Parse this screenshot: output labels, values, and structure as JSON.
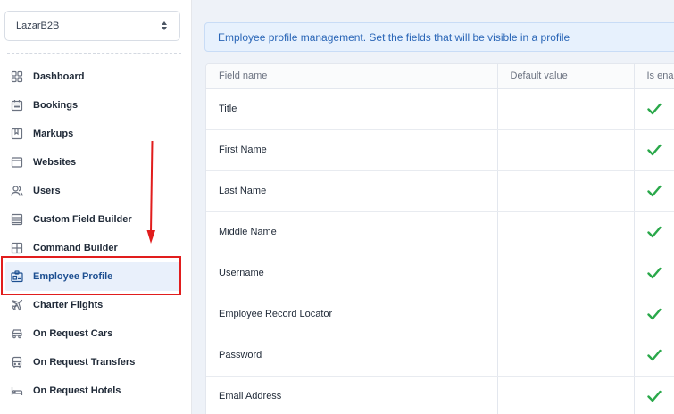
{
  "company_select": {
    "value": "LazarB2B"
  },
  "sidebar": {
    "items": [
      {
        "label": "Dashboard",
        "icon": "grid-icon"
      },
      {
        "label": "Bookings",
        "icon": "calendar-icon"
      },
      {
        "label": "Markups",
        "icon": "bookmark-icon"
      },
      {
        "label": "Websites",
        "icon": "browser-icon"
      },
      {
        "label": "Users",
        "icon": "users-icon"
      },
      {
        "label": "Custom Field Builder",
        "icon": "list-icon"
      },
      {
        "label": "Command Builder",
        "icon": "layout-icon"
      },
      {
        "label": "Employee Profile",
        "icon": "id-card-icon",
        "active": true
      },
      {
        "label": "Charter Flights",
        "icon": "plane-icon"
      },
      {
        "label": "On Request Cars",
        "icon": "car-icon"
      },
      {
        "label": "On Request Transfers",
        "icon": "bus-icon"
      },
      {
        "label": "On Request Hotels",
        "icon": "bed-icon"
      }
    ]
  },
  "banner": {
    "text": "Employee profile management. Set the fields that will be visible in a profile"
  },
  "table": {
    "columns": [
      "Field name",
      "Default value",
      "Is enal"
    ],
    "rows": [
      {
        "field": "Title",
        "default": "",
        "enabled": true
      },
      {
        "field": "First Name",
        "default": "",
        "enabled": true
      },
      {
        "field": "Last Name",
        "default": "",
        "enabled": true
      },
      {
        "field": "Middle Name",
        "default": "",
        "enabled": true
      },
      {
        "field": "Username",
        "default": "",
        "enabled": true
      },
      {
        "field": "Employee Record Locator",
        "default": "",
        "enabled": true
      },
      {
        "field": "Password",
        "default": "",
        "enabled": true
      },
      {
        "field": "Email Address",
        "default": "",
        "enabled": true
      }
    ]
  },
  "colors": {
    "accent": "#2a66b7",
    "active_bg": "#e9f0fb",
    "check": "#2aa84a",
    "annotation": "#e11d1d"
  }
}
